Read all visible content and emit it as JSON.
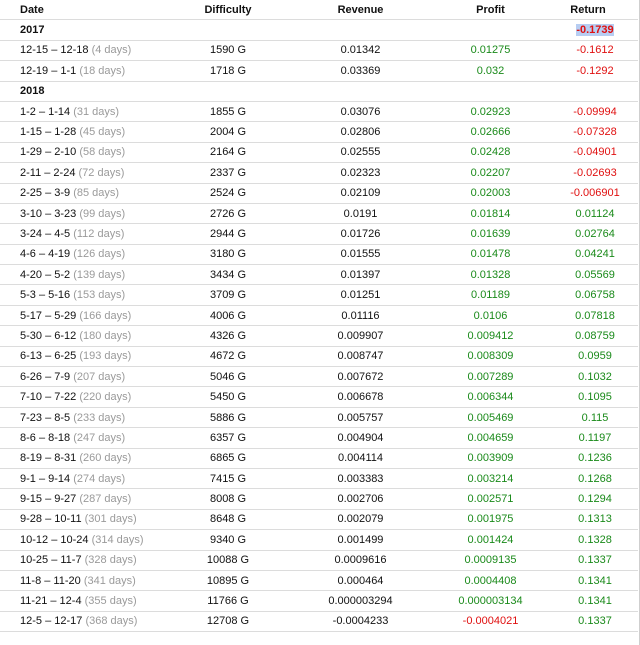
{
  "headers": {
    "date": "Date",
    "difficulty": "Difficulty",
    "revenue": "Revenue",
    "profit": "Profit",
    "return": "Return"
  },
  "sections": [
    {
      "year": "2017",
      "year_return": "-0.1739",
      "rows": [
        {
          "date": "12-15 – 12-18",
          "days": "(4 days)",
          "difficulty": "1590 G",
          "revenue": "0.01342",
          "profit": "0.01275",
          "return": "-0.1612"
        },
        {
          "date": "12-19 – 1-1",
          "days": "(18 days)",
          "difficulty": "1718 G",
          "revenue": "0.03369",
          "profit": "0.032",
          "return": "-0.1292"
        }
      ]
    },
    {
      "year": "2018",
      "year_return": "",
      "rows": [
        {
          "date": "1-2 – 1-14",
          "days": "(31 days)",
          "difficulty": "1855 G",
          "revenue": "0.03076",
          "profit": "0.02923",
          "return": "-0.09994"
        },
        {
          "date": "1-15 – 1-28",
          "days": "(45 days)",
          "difficulty": "2004 G",
          "revenue": "0.02806",
          "profit": "0.02666",
          "return": "-0.07328"
        },
        {
          "date": "1-29 – 2-10",
          "days": "(58 days)",
          "difficulty": "2164 G",
          "revenue": "0.02555",
          "profit": "0.02428",
          "return": "-0.04901"
        },
        {
          "date": "2-11 – 2-24",
          "days": "(72 days)",
          "difficulty": "2337 G",
          "revenue": "0.02323",
          "profit": "0.02207",
          "return": "-0.02693"
        },
        {
          "date": "2-25 – 3-9",
          "days": "(85 days)",
          "difficulty": "2524 G",
          "revenue": "0.02109",
          "profit": "0.02003",
          "return": "-0.006901"
        },
        {
          "date": "3-10 – 3-23",
          "days": "(99 days)",
          "difficulty": "2726 G",
          "revenue": "0.0191",
          "profit": "0.01814",
          "return": "0.01124"
        },
        {
          "date": "3-24 – 4-5",
          "days": "(112 days)",
          "difficulty": "2944 G",
          "revenue": "0.01726",
          "profit": "0.01639",
          "return": "0.02764"
        },
        {
          "date": "4-6 – 4-19",
          "days": "(126 days)",
          "difficulty": "3180 G",
          "revenue": "0.01555",
          "profit": "0.01478",
          "return": "0.04241"
        },
        {
          "date": "4-20 – 5-2",
          "days": "(139 days)",
          "difficulty": "3434 G",
          "revenue": "0.01397",
          "profit": "0.01328",
          "return": "0.05569"
        },
        {
          "date": "5-3 – 5-16",
          "days": "(153 days)",
          "difficulty": "3709 G",
          "revenue": "0.01251",
          "profit": "0.01189",
          "return": "0.06758"
        },
        {
          "date": "5-17 – 5-29",
          "days": "(166 days)",
          "difficulty": "4006 G",
          "revenue": "0.01116",
          "profit": "0.0106",
          "return": "0.07818"
        },
        {
          "date": "5-30 – 6-12",
          "days": "(180 days)",
          "difficulty": "4326 G",
          "revenue": "0.009907",
          "profit": "0.009412",
          "return": "0.08759"
        },
        {
          "date": "6-13 – 6-25",
          "days": "(193 days)",
          "difficulty": "4672 G",
          "revenue": "0.008747",
          "profit": "0.008309",
          "return": "0.0959"
        },
        {
          "date": "6-26 – 7-9",
          "days": "(207 days)",
          "difficulty": "5046 G",
          "revenue": "0.007672",
          "profit": "0.007289",
          "return": "0.1032"
        },
        {
          "date": "7-10 – 7-22",
          "days": "(220 days)",
          "difficulty": "5450 G",
          "revenue": "0.006678",
          "profit": "0.006344",
          "return": "0.1095"
        },
        {
          "date": "7-23 – 8-5",
          "days": "(233 days)",
          "difficulty": "5886 G",
          "revenue": "0.005757",
          "profit": "0.005469",
          "return": "0.115"
        },
        {
          "date": "8-6 – 8-18",
          "days": "(247 days)",
          "difficulty": "6357 G",
          "revenue": "0.004904",
          "profit": "0.004659",
          "return": "0.1197"
        },
        {
          "date": "8-19 – 8-31",
          "days": "(260 days)",
          "difficulty": "6865 G",
          "revenue": "0.004114",
          "profit": "0.003909",
          "return": "0.1236"
        },
        {
          "date": "9-1 – 9-14",
          "days": "(274 days)",
          "difficulty": "7415 G",
          "revenue": "0.003383",
          "profit": "0.003214",
          "return": "0.1268"
        },
        {
          "date": "9-15 – 9-27",
          "days": "(287 days)",
          "difficulty": "8008 G",
          "revenue": "0.002706",
          "profit": "0.002571",
          "return": "0.1294"
        },
        {
          "date": "9-28 – 10-11",
          "days": "(301 days)",
          "difficulty": "8648 G",
          "revenue": "0.002079",
          "profit": "0.001975",
          "return": "0.1313"
        },
        {
          "date": "10-12 – 10-24",
          "days": "(314 days)",
          "difficulty": "9340 G",
          "revenue": "0.001499",
          "profit": "0.001424",
          "return": "0.1328"
        },
        {
          "date": "10-25 – 11-7",
          "days": "(328 days)",
          "difficulty": "10088 G",
          "revenue": "0.0009616",
          "profit": "0.0009135",
          "return": "0.1337"
        },
        {
          "date": "11-8 – 11-20",
          "days": "(341 days)",
          "difficulty": "10895 G",
          "revenue": "0.000464",
          "profit": "0.0004408",
          "return": "0.1341"
        },
        {
          "date": "11-21 – 12-4",
          "days": "(355 days)",
          "difficulty": "11766 G",
          "revenue": "0.000003294",
          "profit": "0.000003134",
          "return": "0.1341"
        },
        {
          "date": "12-5 – 12-17",
          "days": "(368 days)",
          "difficulty": "12708 G",
          "revenue": "-0.0004233",
          "profit": "-0.0004021",
          "return": "0.1337"
        }
      ]
    }
  ],
  "colors": {
    "positive": "#1a8a1a",
    "negative": "#e01010",
    "muted": "#9a9a9a",
    "highlight": "#b7cdf2"
  }
}
